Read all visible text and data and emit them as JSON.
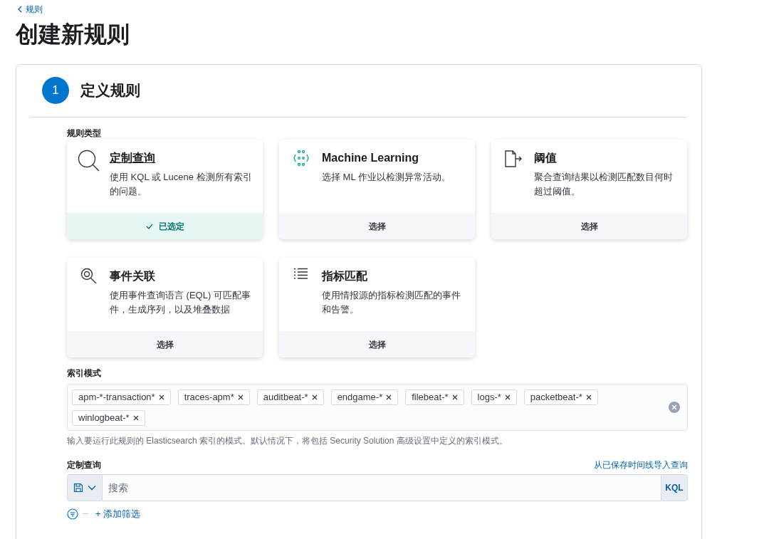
{
  "back_link": "规则",
  "page_title": "创建新规则",
  "step": {
    "number": "1",
    "title": "定义规则"
  },
  "rule_type": {
    "label": "规则类型",
    "cards": [
      {
        "kind": "query",
        "title": "定制查询",
        "description": "使用 KQL 或 Lucene 检测所有索引的问题。",
        "action": "已选定",
        "selected": true
      },
      {
        "kind": "ml",
        "title": "Machine Learning",
        "description": "选择 ML 作业以检测异常活动。",
        "action": "选择",
        "selected": false
      },
      {
        "kind": "threshold",
        "title": "阈值",
        "description": "聚合查询结果以检测匹配数目何时超过阈值。",
        "action": "选择",
        "selected": false
      },
      {
        "kind": "eql",
        "title": "事件关联",
        "description": "使用事件查询语言 (EQL) 可匹配事件，生成序列，以及堆叠数据",
        "action": "选择",
        "selected": false
      },
      {
        "kind": "threat",
        "title": "指标匹配",
        "description": "使用情报源的指标检测匹配的事件和告警。",
        "action": "选择",
        "selected": false
      }
    ]
  },
  "index_patterns": {
    "label": "索引模式",
    "tags": [
      "apm-*-transaction*",
      "traces-apm*",
      "auditbeat-*",
      "endgame-*",
      "filebeat-*",
      "logs-*",
      "packetbeat-*",
      "winlogbeat-*"
    ],
    "help": "输入要运行此规则的 Elasticsearch 索引的模式。默认情况下，将包括 Security Solution 高级设置中定义的索引模式。"
  },
  "custom_query": {
    "label": "定制查询",
    "import_link": "从已保存时间线导入查询",
    "placeholder": "搜索",
    "language": "KQL",
    "add_filter": "+ 添加筛选"
  }
}
